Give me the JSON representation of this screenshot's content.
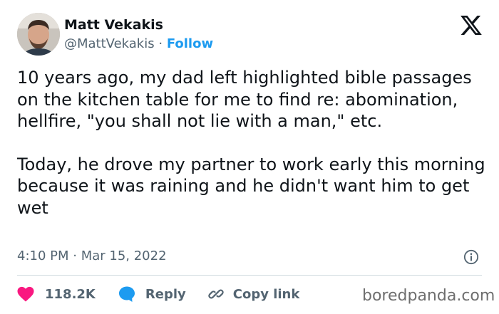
{
  "author": {
    "name": "Matt Vekakis",
    "handle": "@MattVekakis",
    "separator": "·",
    "follow_label": "Follow"
  },
  "tweet": {
    "paragraphs": [
      "10 years ago, my dad left highlighted bible passages on the kitchen table for me to find re: abomination, hellfire, \"you shall not lie with a man,\" etc.",
      "Today, he drove my partner to work early this morning because it was raining and he didn't want him to get wet"
    ],
    "timestamp": "4:10 PM · Mar 15, 2022"
  },
  "actions": {
    "like_count": "118.2K",
    "reply_label": "Reply",
    "copy_link_label": "Copy link"
  },
  "watermark": "boredpanda.com",
  "icons": {
    "platform_logo": "x-logo-icon",
    "info": "info-icon",
    "like": "heart-icon",
    "reply": "speech-bubble-icon",
    "copy_link": "link-icon"
  },
  "colors": {
    "text": "#0f1419",
    "secondary": "#536471",
    "follow": "#1d9bf0",
    "like": "#f91880",
    "reply": "#1d9bf0",
    "divider": "#cfd9de"
  }
}
